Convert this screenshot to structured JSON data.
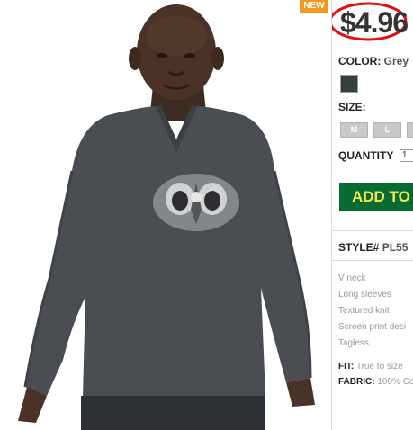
{
  "badge": {
    "new": "NEW"
  },
  "price": "$4.96",
  "color": {
    "label": "COLOR:",
    "value": "Grey"
  },
  "size": {
    "label": "SIZE:",
    "options": [
      "M",
      "L"
    ]
  },
  "quantity": {
    "label": "QUANTITY",
    "value": "1"
  },
  "cart": {
    "add_label": "ADD TO"
  },
  "style": {
    "label": "STYLE#",
    "value": "PL55"
  },
  "features": [
    "V neck",
    "Long sleeves",
    "Textured knit",
    "Screen print desi",
    "Tagless"
  ],
  "fit": {
    "label": "FIT:",
    "value": "True to size"
  },
  "fabric": {
    "label": "FABRIC:",
    "value": "100% Co"
  },
  "colors": {
    "button_green": "#0a6b32",
    "button_text": "#f3e84a",
    "badge": "#f39a1e",
    "circle": "#e01010",
    "shirt": "#4a4d52"
  }
}
